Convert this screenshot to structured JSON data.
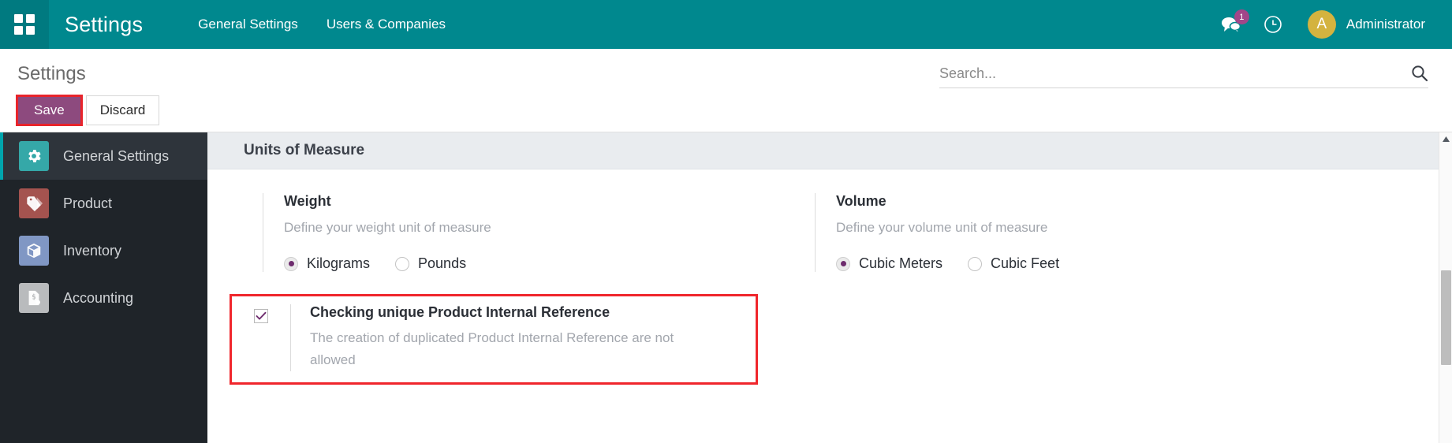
{
  "navbar": {
    "apps_icon": "grid-apps-icon",
    "brand": "Settings",
    "links": [
      {
        "label": "General Settings"
      },
      {
        "label": "Users & Companies"
      }
    ],
    "messages_icon": "messages-icon",
    "messages_badge": "1",
    "activity_icon": "clock-activity-icon",
    "avatar_initial": "A",
    "user_name": "Administrator",
    "bg_color": "#00888e"
  },
  "control_panel": {
    "breadcrumb": "Settings",
    "save_label": "Save",
    "discard_label": "Discard",
    "save_color": "#8d4a7e",
    "highlight_color": "#e8242b"
  },
  "search": {
    "placeholder": "Search...",
    "value": "",
    "icon": "search-icon"
  },
  "sidebar": {
    "items": [
      {
        "label": "General Settings",
        "icon": "gear-icon",
        "active": true
      },
      {
        "label": "Product",
        "icon": "tag-icon",
        "active": false
      },
      {
        "label": "Inventory",
        "icon": "box-icon",
        "active": false
      },
      {
        "label": "Accounting",
        "icon": "invoice-dollar-icon",
        "active": false
      }
    ]
  },
  "settings": {
    "section_title": "Units of Measure",
    "weight": {
      "title": "Weight",
      "description": "Define your weight unit of measure",
      "options": [
        {
          "label": "Kilograms",
          "selected": true
        },
        {
          "label": "Pounds",
          "selected": false
        }
      ]
    },
    "volume": {
      "title": "Volume",
      "description": "Define your volume unit of measure",
      "options": [
        {
          "label": "Cubic Meters",
          "selected": true
        },
        {
          "label": "Cubic Feet",
          "selected": false
        }
      ]
    },
    "unique_reference": {
      "title": "Checking unique Product Internal Reference",
      "description": "The creation of duplicated Product Internal Reference are not allowed",
      "checked": true
    }
  }
}
